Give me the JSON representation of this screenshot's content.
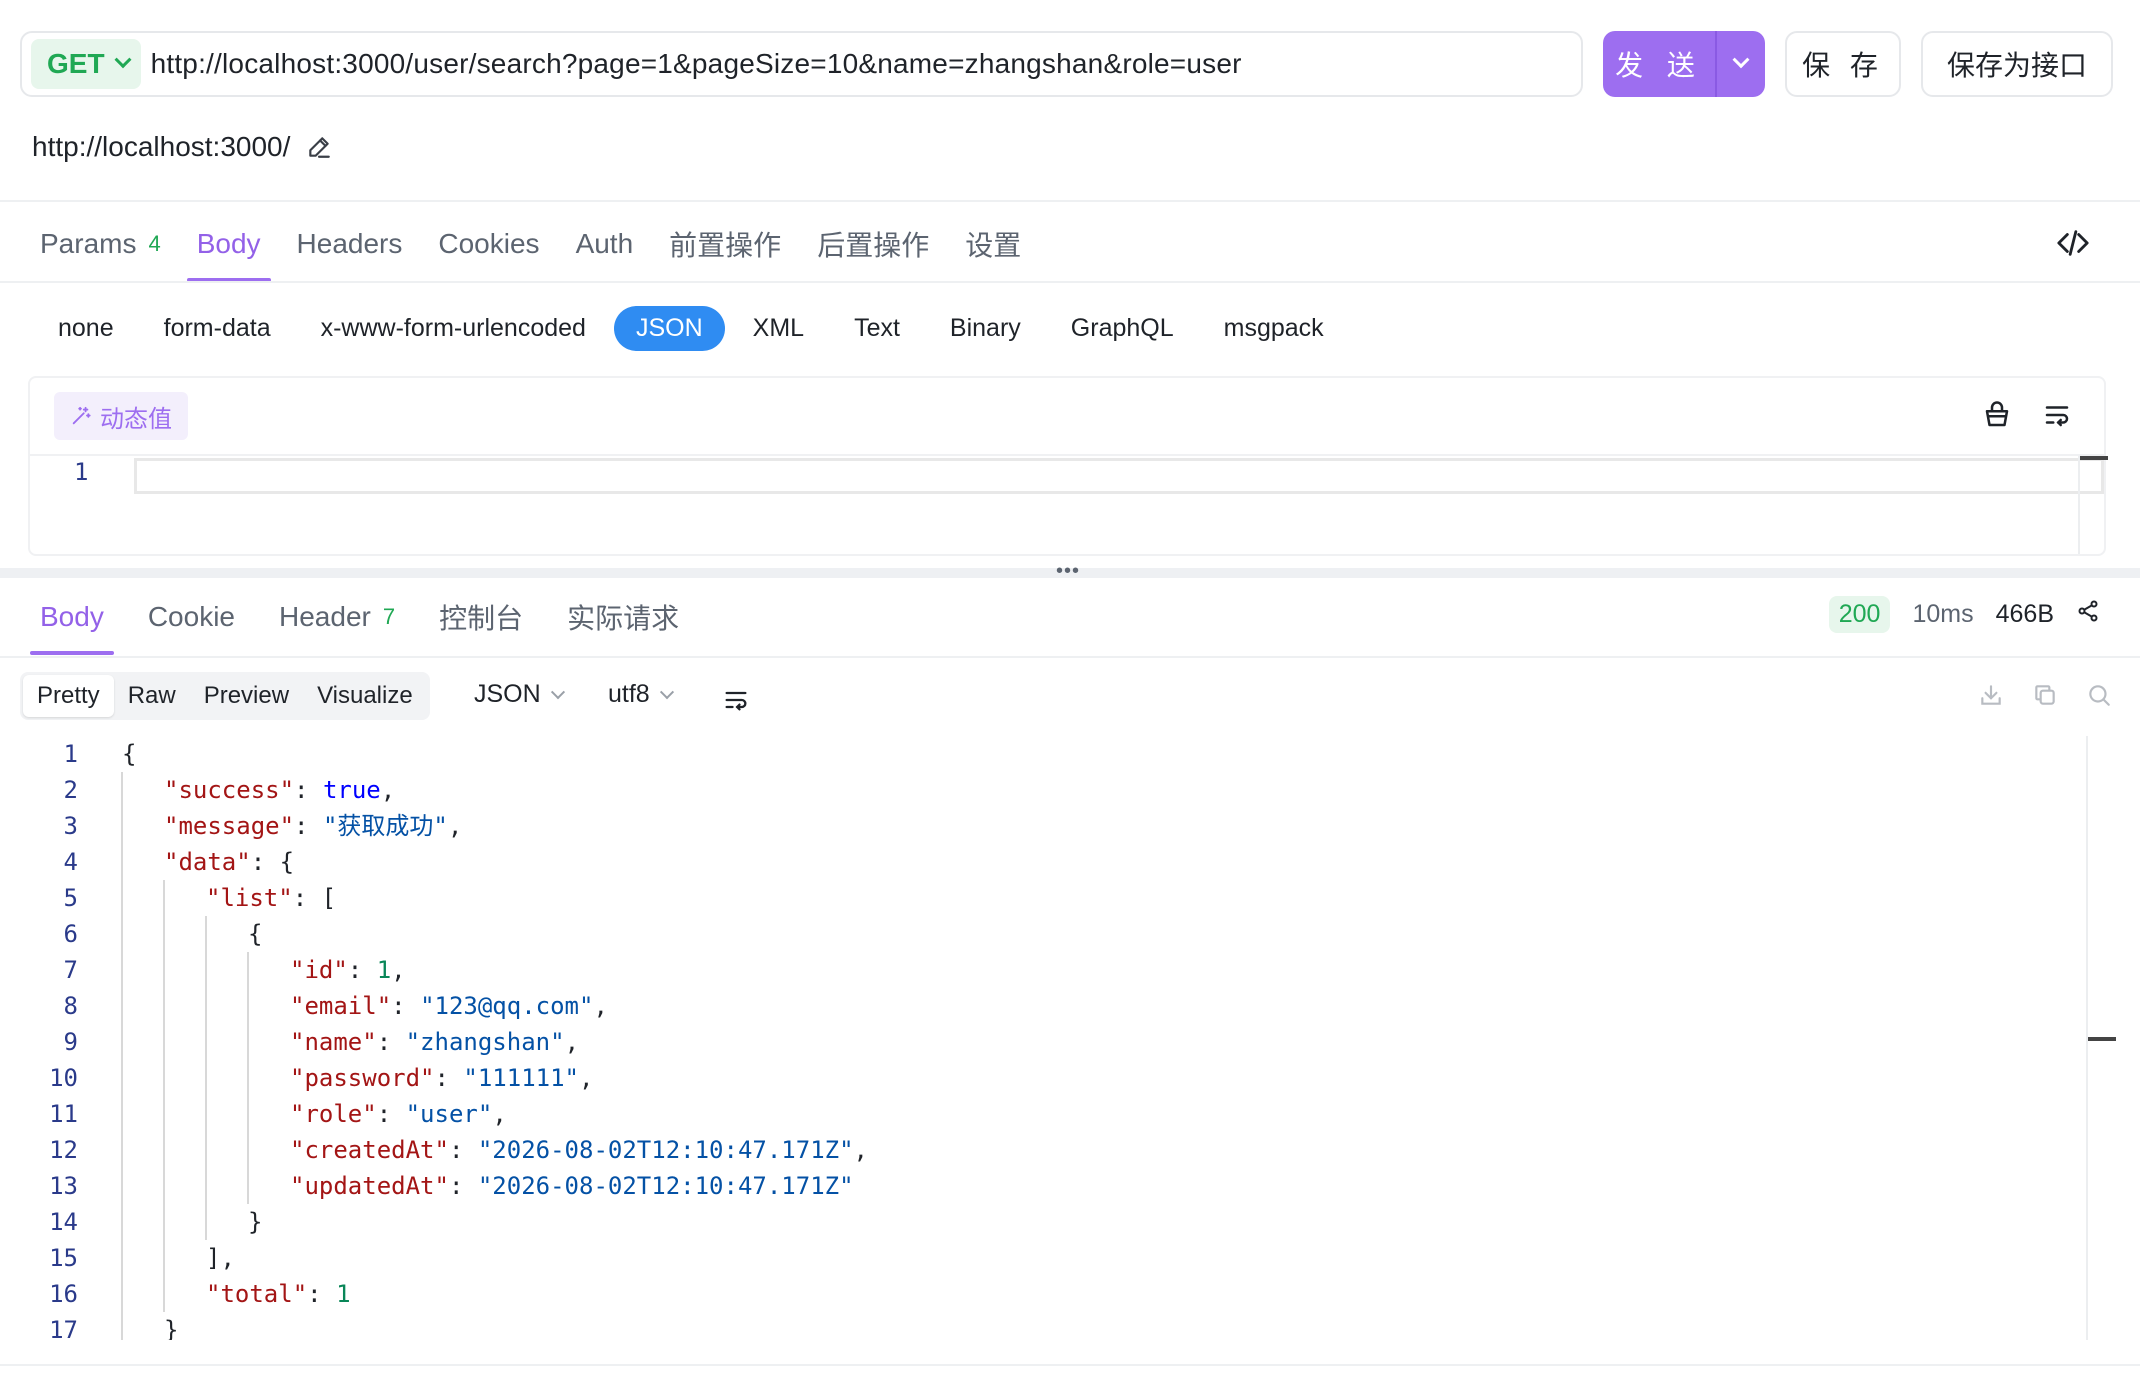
{
  "request": {
    "method": "GET",
    "url": "http://localhost:3000/user/search?page=1&pageSize=10&name=zhangshan&role=user",
    "send_label": "发 送",
    "save_label": "保 存",
    "save_api_label": "保存为接口",
    "base_url": "http://localhost:3000/"
  },
  "request_tabs": [
    {
      "label": "Params",
      "count": "4"
    },
    {
      "label": "Body",
      "count": ""
    },
    {
      "label": "Headers",
      "count": ""
    },
    {
      "label": "Cookies",
      "count": ""
    },
    {
      "label": "Auth",
      "count": ""
    },
    {
      "label": "前置操作",
      "count": ""
    },
    {
      "label": "后置操作",
      "count": ""
    },
    {
      "label": "设置",
      "count": ""
    }
  ],
  "active_request_tab": "Body",
  "body_types": [
    "none",
    "form-data",
    "x-www-form-urlencoded",
    "JSON",
    "XML",
    "Text",
    "Binary",
    "GraphQL",
    "msgpack"
  ],
  "active_body_type": "JSON",
  "editor": {
    "dynamic_value_label": "动态值",
    "line_number": "1",
    "content": ""
  },
  "response_tabs": [
    {
      "label": "Body",
      "count": ""
    },
    {
      "label": "Cookie",
      "count": ""
    },
    {
      "label": "Header",
      "count": "7"
    },
    {
      "label": "控制台",
      "count": ""
    },
    {
      "label": "实际请求",
      "count": ""
    }
  ],
  "active_response_tab": "Body",
  "response_meta": {
    "status": "200",
    "time": "10ms",
    "size": "466B"
  },
  "view_modes": [
    "Pretty",
    "Raw",
    "Preview",
    "Visualize"
  ],
  "active_view_mode": "Pretty",
  "format": "JSON",
  "encoding": "utf8",
  "response_lines": [
    {
      "n": "1",
      "indent": 0,
      "tokens": [
        [
          "p",
          "{"
        ]
      ]
    },
    {
      "n": "2",
      "indent": 1,
      "tokens": [
        [
          "k",
          "\"success\""
        ],
        [
          "p",
          ": "
        ],
        [
          "b",
          "true"
        ],
        [
          "p",
          ","
        ]
      ]
    },
    {
      "n": "3",
      "indent": 1,
      "tokens": [
        [
          "k",
          "\"message\""
        ],
        [
          "p",
          ": "
        ],
        [
          "s",
          "\"获取成功\""
        ],
        [
          "p",
          ","
        ]
      ]
    },
    {
      "n": "4",
      "indent": 1,
      "tokens": [
        [
          "k",
          "\"data\""
        ],
        [
          "p",
          ": {"
        ]
      ]
    },
    {
      "n": "5",
      "indent": 2,
      "tokens": [
        [
          "k",
          "\"list\""
        ],
        [
          "p",
          ": ["
        ]
      ]
    },
    {
      "n": "6",
      "indent": 3,
      "tokens": [
        [
          "p",
          "{"
        ]
      ]
    },
    {
      "n": "7",
      "indent": 4,
      "tokens": [
        [
          "k",
          "\"id\""
        ],
        [
          "p",
          ": "
        ],
        [
          "n",
          "1"
        ],
        [
          "p",
          ","
        ]
      ]
    },
    {
      "n": "8",
      "indent": 4,
      "tokens": [
        [
          "k",
          "\"email\""
        ],
        [
          "p",
          ": "
        ],
        [
          "s",
          "\"123@qq.com\""
        ],
        [
          "p",
          ","
        ]
      ]
    },
    {
      "n": "9",
      "indent": 4,
      "tokens": [
        [
          "k",
          "\"name\""
        ],
        [
          "p",
          ": "
        ],
        [
          "s",
          "\"zhangshan\""
        ],
        [
          "p",
          ","
        ]
      ]
    },
    {
      "n": "10",
      "indent": 4,
      "tokens": [
        [
          "k",
          "\"password\""
        ],
        [
          "p",
          ": "
        ],
        [
          "s",
          "\"111111\""
        ],
        [
          "p",
          ","
        ]
      ]
    },
    {
      "n": "11",
      "indent": 4,
      "tokens": [
        [
          "k",
          "\"role\""
        ],
        [
          "p",
          ": "
        ],
        [
          "s",
          "\"user\""
        ],
        [
          "p",
          ","
        ]
      ]
    },
    {
      "n": "12",
      "indent": 4,
      "tokens": [
        [
          "k",
          "\"createdAt\""
        ],
        [
          "p",
          ": "
        ],
        [
          "s",
          "\"2026-08-02T12:10:47.171Z\""
        ],
        [
          "p",
          ","
        ]
      ]
    },
    {
      "n": "13",
      "indent": 4,
      "tokens": [
        [
          "k",
          "\"updatedAt\""
        ],
        [
          "p",
          ": "
        ],
        [
          "s",
          "\"2026-08-02T12:10:47.171Z\""
        ]
      ]
    },
    {
      "n": "14",
      "indent": 3,
      "tokens": [
        [
          "p",
          "}"
        ]
      ]
    },
    {
      "n": "15",
      "indent": 2,
      "tokens": [
        [
          "p",
          "],"
        ]
      ]
    },
    {
      "n": "16",
      "indent": 2,
      "tokens": [
        [
          "k",
          "\"total\""
        ],
        [
          "p",
          ": "
        ],
        [
          "n",
          "1"
        ]
      ]
    },
    {
      "n": "17",
      "indent": 1,
      "tokens": [
        [
          "p",
          "}"
        ]
      ]
    }
  ],
  "colors": {
    "accent": "#9d6ef0",
    "method_green": "#20a854",
    "json_pill": "#2f8cf2"
  }
}
